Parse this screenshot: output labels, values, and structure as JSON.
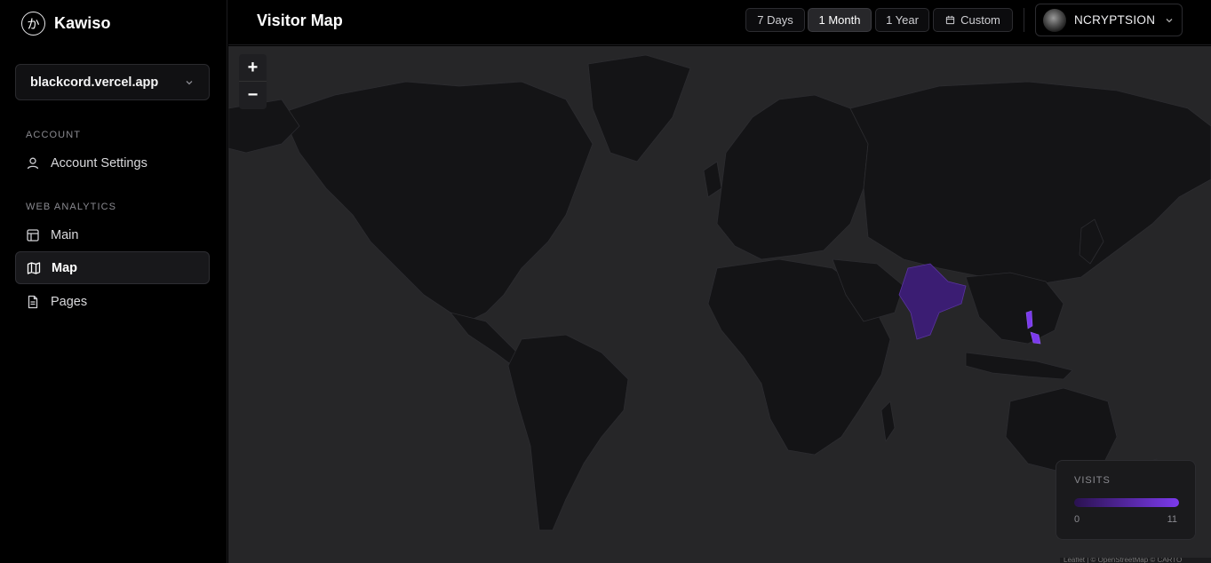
{
  "brand": {
    "logo_glyph": "か",
    "name": "Kawiso"
  },
  "site_selector": {
    "value": "blackcord.vercel.app"
  },
  "sidebar": {
    "sections": [
      {
        "label": "ACCOUNT"
      },
      {
        "label": "WEB ANALYTICS"
      }
    ],
    "items": [
      {
        "label": "Account Settings",
        "icon": "user-icon"
      },
      {
        "label": "Main",
        "icon": "layout-icon"
      },
      {
        "label": "Map",
        "icon": "map-icon",
        "active": true
      },
      {
        "label": "Pages",
        "icon": "file-text-icon"
      }
    ]
  },
  "header": {
    "title": "Visitor Map",
    "ranges": [
      {
        "label": "7 Days"
      },
      {
        "label": "1 Month",
        "active": true
      },
      {
        "label": "1 Year"
      },
      {
        "label": "Custom",
        "icon": "calendar-icon"
      }
    ],
    "user": {
      "name": "NCRYPTSION"
    }
  },
  "map": {
    "zoom_in": "+",
    "zoom_out": "−",
    "highlighted_regions": [
      "India",
      "Philippines"
    ],
    "legend": {
      "title": "VISITS",
      "min": "0",
      "max": "11",
      "color_low": "#2a1250",
      "color_high": "#7c3aed"
    },
    "attribution": "Leaflet | © OpenStreetMap © CARTO"
  },
  "colors": {
    "background": "#000000",
    "map_water": "#262628",
    "map_land": "#141416",
    "accent": "#7c3aed"
  }
}
